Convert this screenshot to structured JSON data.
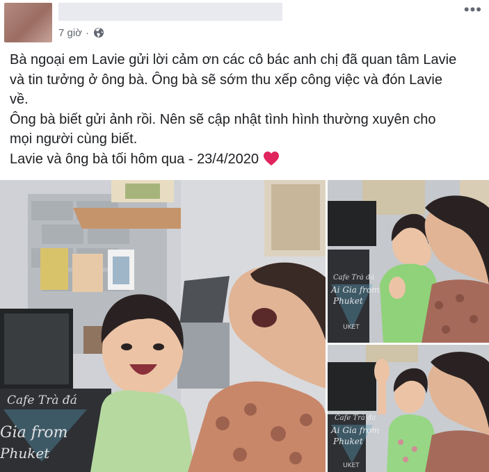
{
  "post": {
    "timestamp": "7 giờ",
    "separator": "·",
    "privacy_icon": "globe-icon",
    "more_icon": "ellipsis-icon",
    "more_label": "•••",
    "caption_lines": [
      "Bà ngoại em Lavie gửi lời cảm ơn các cô bác anh chị đã quan tâm Lavie",
      "và tin tưởng ở ông bà. Ông bà sẽ sớm thu xếp công việc và đón Lavie",
      "về.",
      "Ông bà biết gửi ảnh rồi. Nên sẽ cập nhật tình hình thường xuyên cho",
      "mọi người cùng biết.",
      "Lavie và ông bà tối hôm qua - 23/4/2020"
    ],
    "caption_emoji": "heart-icon",
    "colors": {
      "heart": "#e0245e",
      "meta_text": "#616770",
      "text": "#1c1e21"
    }
  },
  "photos": {
    "main_watermark": [
      "Cafe Trà đá",
      "Gia from",
      "Phuket"
    ],
    "top_watermark": [
      "Cafe Trà đá",
      "Ai Gia from",
      "Phuket",
      "UKET"
    ],
    "bottom_watermark": [
      "Cafe Trà đá",
      "Ai Gia from",
      "Phuket",
      "UKET"
    ]
  }
}
